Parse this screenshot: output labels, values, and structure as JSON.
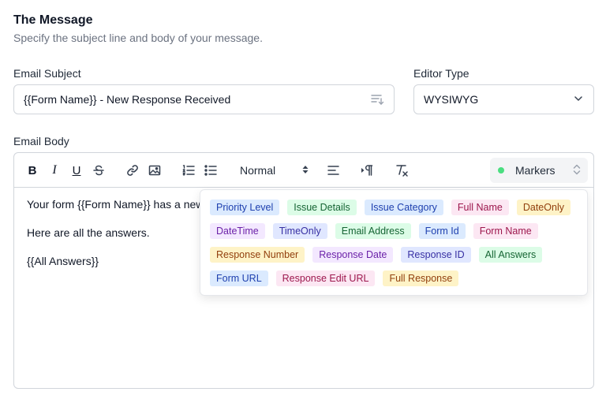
{
  "section": {
    "title": "The Message",
    "subtitle": "Specify the subject line and body of your message."
  },
  "subject": {
    "label": "Email Subject",
    "value": "{{Form Name}} - New Response Received",
    "insert_icon": "insert-variable-icon"
  },
  "editor_type": {
    "label": "Editor Type",
    "value": "WYSIWYG"
  },
  "body": {
    "label": "Email Body",
    "toolbar": {
      "bold": "B",
      "italic": "I",
      "underline": "U",
      "size_value": "Normal",
      "markers_label": "Markers",
      "markers_dot_color": "#4ade80"
    },
    "lines": [
      "Your form {{Form Name}} has a new",
      "Here are all the answers.",
      "{{All Answers}}"
    ]
  },
  "markers": [
    {
      "label": "Priority Level",
      "color": "blue"
    },
    {
      "label": "Issue Details",
      "color": "green"
    },
    {
      "label": "Issue Category",
      "color": "blue"
    },
    {
      "label": "Full Name",
      "color": "pink"
    },
    {
      "label": "DateOnly",
      "color": "yellow"
    },
    {
      "label": "DateTime",
      "color": "purple"
    },
    {
      "label": "TimeOnly",
      "color": "indigo"
    },
    {
      "label": "Email Address",
      "color": "green"
    },
    {
      "label": "Form Id",
      "color": "blue"
    },
    {
      "label": "Form Name",
      "color": "pink"
    },
    {
      "label": "Response Number",
      "color": "yellow"
    },
    {
      "label": "Response Date",
      "color": "purple"
    },
    {
      "label": "Response ID",
      "color": "indigo"
    },
    {
      "label": "All Answers",
      "color": "green"
    },
    {
      "label": "Form URL",
      "color": "blue"
    },
    {
      "label": "Response Edit URL",
      "color": "pink"
    },
    {
      "label": "Full Response",
      "color": "yellow"
    }
  ]
}
